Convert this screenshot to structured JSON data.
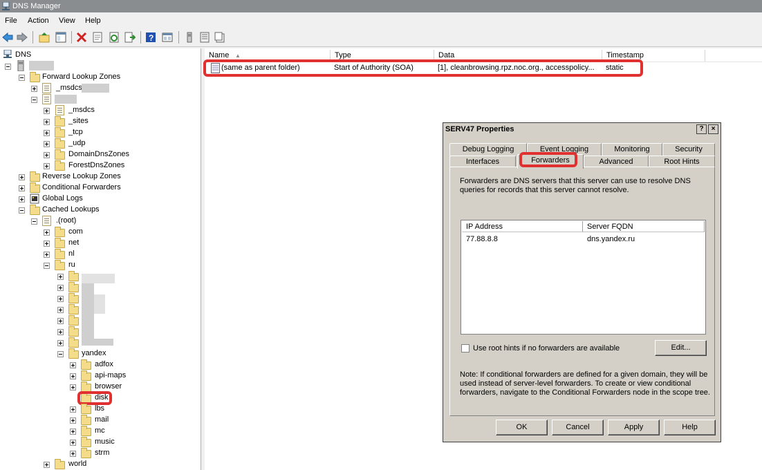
{
  "window": {
    "title": "DNS Manager"
  },
  "menu": [
    "File",
    "Action",
    "View",
    "Help"
  ],
  "toolbar_icons": [
    "back-icon",
    "forward-icon",
    "up-folder-icon",
    "show-hide-tree-icon",
    "delete-icon",
    "properties-icon",
    "refresh-icon",
    "export-list-icon",
    "help-icon",
    "mmc-icon",
    "server-icon",
    "record-icon",
    "zone-icon"
  ],
  "tree": {
    "root": "DNS",
    "forward_lookup_zones": "Forward Lookup Zones",
    "msdcs_zone": "_msdcs.",
    "sub": [
      "_msdcs",
      "_sites",
      "_tcp",
      "_udp",
      "DomainDnsZones",
      "ForestDnsZones"
    ],
    "reverse_lookup_zones": "Reverse Lookup Zones",
    "conditional_forwarders": "Conditional Forwarders",
    "global_logs": "Global Logs",
    "cached_lookups": "Cached Lookups",
    "root_zone": ".(root)",
    "tlds": [
      "com",
      "net",
      "nl",
      "ru"
    ],
    "yandex": "yandex",
    "yandex_children": [
      "adfox",
      "api-maps",
      "browser",
      "disk",
      "lbs",
      "mail",
      "mc",
      "music",
      "strm"
    ],
    "world": "world"
  },
  "list": {
    "columns": [
      "Name",
      "Type",
      "Data",
      "Timestamp"
    ],
    "rows": [
      {
        "name": "(same as parent folder)",
        "type": "Start of Authority (SOA)",
        "data": "[1], cleanbrowsing.rpz.noc.org., accesspolicy...",
        "timestamp": "static"
      }
    ]
  },
  "dialog": {
    "title": "SERV47 Properties",
    "help_btn": "?",
    "close_btn": "×",
    "tabs_row1": [
      "Debug Logging",
      "Event Logging",
      "Monitoring",
      "Security"
    ],
    "tabs_row2": [
      "Interfaces",
      "Forwarders",
      "Advanced",
      "Root Hints"
    ],
    "active_tab": "Forwarders",
    "description_line1": "Forwarders are DNS servers that this server can use to resolve DNS",
    "description_line2": "queries for records that this server cannot resolve.",
    "columns": [
      "IP Address",
      "Server FQDN"
    ],
    "forwarders": [
      {
        "ip": "77.88.8.8",
        "fqdn": "dns.yandex.ru"
      }
    ],
    "use_root_hints_label": "Use root hints if no forwarders are available",
    "use_root_hints_checked": false,
    "edit_button": "Edit...",
    "note_line1": "Note: If conditional forwarders are defined for a given domain, they will be",
    "note_line2": "used instead of server-level forwarders.  To create or view conditional",
    "note_line3": "forwarders, navigate to the Conditional Forwarders node in the scope tree.",
    "buttons": [
      "OK",
      "Cancel",
      "Apply",
      "Help"
    ]
  }
}
